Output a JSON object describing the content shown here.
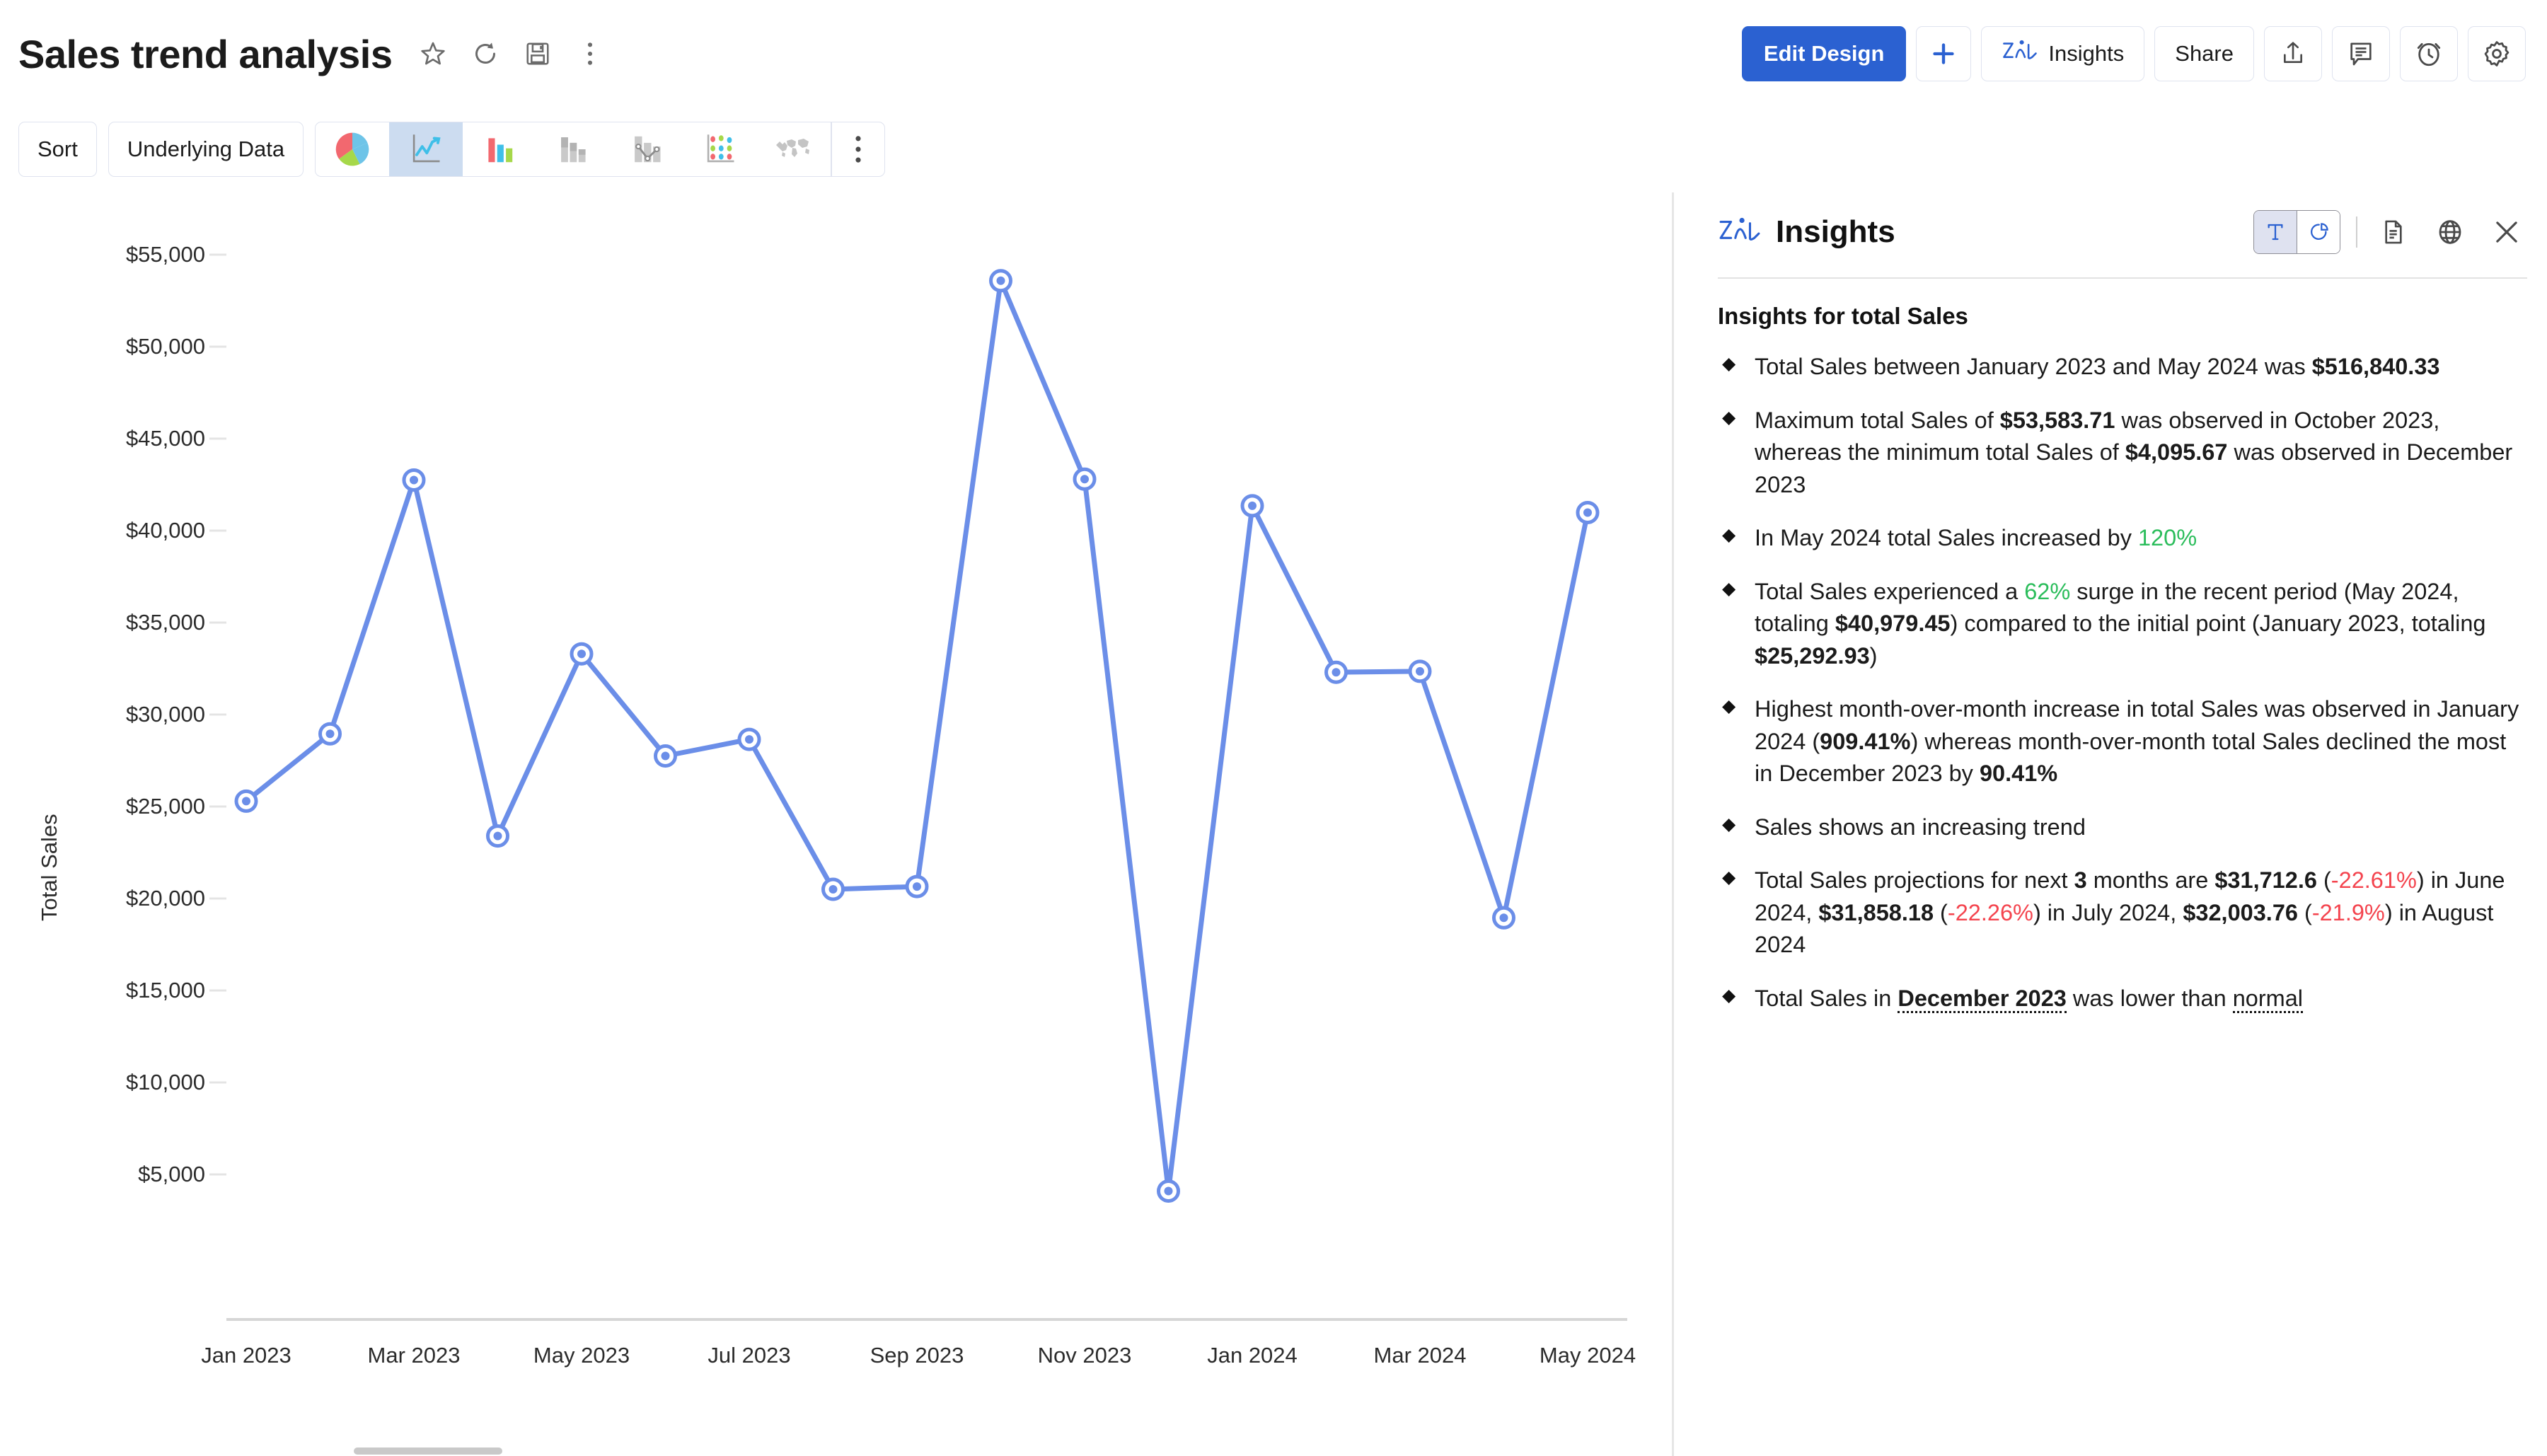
{
  "header": {
    "title": "Sales trend analysis",
    "icons": [
      {
        "name": "favorite-star-icon",
        "glyph": "star"
      },
      {
        "name": "refresh-icon",
        "glyph": "refresh"
      },
      {
        "name": "save-icon",
        "glyph": "save"
      },
      {
        "name": "more-options-icon",
        "glyph": "kebab"
      }
    ],
    "edit_design_label": "Edit Design",
    "add_label": "+",
    "insights_label": "Insights",
    "share_label": "Share",
    "right_icons": [
      {
        "name": "export-icon",
        "glyph": "export"
      },
      {
        "name": "comment-icon",
        "glyph": "comment"
      },
      {
        "name": "alert-clock-icon",
        "glyph": "alarm"
      },
      {
        "name": "settings-gear-icon",
        "glyph": "gear"
      }
    ]
  },
  "toolbar": {
    "sort_label": "Sort",
    "underlying_data_label": "Underlying Data",
    "chart_types": [
      {
        "name": "chart-type-pie",
        "active": false
      },
      {
        "name": "chart-type-line",
        "active": true
      },
      {
        "name": "chart-type-bar",
        "active": false
      },
      {
        "name": "chart-type-stacked-bar",
        "active": false
      },
      {
        "name": "chart-type-combo",
        "active": false
      },
      {
        "name": "chart-type-bubble",
        "active": false
      },
      {
        "name": "chart-type-map",
        "active": false
      }
    ],
    "more_label": "⋮"
  },
  "chart_data": {
    "type": "line",
    "title": "",
    "xlabel": "",
    "ylabel": "Total Sales",
    "ylim": [
      2500,
      55900
    ],
    "grid": true,
    "legend_position": "none",
    "accent_color": "#6b8ee8",
    "ytick_labels": [
      "$55,000",
      "$50,000",
      "$45,000",
      "$40,000",
      "$35,000",
      "$30,000",
      "$25,000",
      "$20,000",
      "$15,000",
      "$10,000",
      "$5,000"
    ],
    "ytick_values": [
      55000,
      50000,
      45000,
      40000,
      35000,
      30000,
      25000,
      20000,
      15000,
      10000,
      5000
    ],
    "xtick_labels": [
      "Jan 2023",
      "Mar 2023",
      "May 2023",
      "Jul 2023",
      "Sep 2023",
      "Nov 2023",
      "Jan 2024",
      "Mar 2024",
      "May 2024"
    ],
    "categories": [
      "Jan 2023",
      "Feb 2023",
      "Mar 2023",
      "Apr 2023",
      "May 2023",
      "Jun 2023",
      "Jul 2023",
      "Aug 2023",
      "Sep 2023",
      "Oct 2023",
      "Nov 2023",
      "Dec 2023",
      "Jan 2024",
      "Feb 2024",
      "Mar 2024",
      "Apr 2024",
      "May 2024"
    ],
    "values": [
      25292.93,
      28950,
      42750,
      23400,
      33300,
      27750,
      28650,
      20500,
      20650,
      53583.71,
      42800,
      4095.67,
      41350,
      32300,
      32350,
      18950,
      40979.45
    ],
    "series": [
      {
        "name": "Total Sales",
        "values": [
          25292.93,
          28950,
          42750,
          23400,
          33300,
          27750,
          28650,
          20500,
          20650,
          53583.71,
          42800,
          4095.67,
          41350,
          32300,
          32350,
          18950,
          40979.45
        ]
      }
    ]
  },
  "insights": {
    "panel_title": "Insights",
    "subtitle": "Insights for total Sales",
    "toggle": [
      {
        "name": "insights-text-view-toggle",
        "label": "T",
        "active": true
      },
      {
        "name": "insights-chart-view-toggle",
        "label": "pie",
        "active": false
      }
    ],
    "header_icons": [
      {
        "name": "document-export-icon"
      },
      {
        "name": "globe-icon"
      },
      {
        "name": "close-icon"
      }
    ],
    "bullets": [
      {
        "id": "total-sales-range",
        "parts": [
          {
            "t": "Total Sales between January 2023 and May 2024 was ",
            "s": "n"
          },
          {
            "t": "$516,840.33",
            "s": "b"
          }
        ]
      },
      {
        "id": "max-min-sales",
        "parts": [
          {
            "t": "Maximum total Sales of ",
            "s": "n"
          },
          {
            "t": "$53,583.71",
            "s": "b"
          },
          {
            "t": " was observed in October 2023, whereas the minimum total Sales of ",
            "s": "n"
          },
          {
            "t": "$4,095.67",
            "s": "b"
          },
          {
            "t": " was observed in December 2023",
            "s": "n"
          }
        ]
      },
      {
        "id": "may-2024-increase",
        "parts": [
          {
            "t": "In May 2024 total Sales increased by ",
            "s": "n"
          },
          {
            "t": "120%",
            "s": "g"
          }
        ]
      },
      {
        "id": "recent-surge",
        "parts": [
          {
            "t": "Total Sales experienced a ",
            "s": "n"
          },
          {
            "t": "62%",
            "s": "g"
          },
          {
            "t": " surge in the recent period (May 2024, totaling ",
            "s": "n"
          },
          {
            "t": "$40,979.45",
            "s": "b"
          },
          {
            "t": ") compared to the initial point (January 2023, totaling ",
            "s": "n"
          },
          {
            "t": "$25,292.93",
            "s": "b"
          },
          {
            "t": ")",
            "s": "n"
          }
        ]
      },
      {
        "id": "mom-change",
        "parts": [
          {
            "t": "Highest month-over-month increase in total Sales was observed in January 2024 (",
            "s": "n"
          },
          {
            "t": "909.41%",
            "s": "b"
          },
          {
            "t": ") whereas month-over-month total Sales declined the most in December 2023 by ",
            "s": "n"
          },
          {
            "t": "90.41%",
            "s": "b"
          }
        ]
      },
      {
        "id": "trend",
        "parts": [
          {
            "t": "Sales shows an increasing trend",
            "s": "n"
          }
        ]
      },
      {
        "id": "projections",
        "parts": [
          {
            "t": "Total Sales projections for next ",
            "s": "n"
          },
          {
            "t": "3",
            "s": "b"
          },
          {
            "t": " months are ",
            "s": "n"
          },
          {
            "t": "$31,712.6",
            "s": "b"
          },
          {
            "t": " (",
            "s": "n"
          },
          {
            "t": "-22.61%",
            "s": "r"
          },
          {
            "t": ") in June 2024, ",
            "s": "n"
          },
          {
            "t": "$31,858.18",
            "s": "b"
          },
          {
            "t": " (",
            "s": "n"
          },
          {
            "t": "-22.26%",
            "s": "r"
          },
          {
            "t": ") in July 2024, ",
            "s": "n"
          },
          {
            "t": "$32,003.76",
            "s": "b"
          },
          {
            "t": " (",
            "s": "n"
          },
          {
            "t": "-21.9%",
            "s": "r"
          },
          {
            "t": ") in August 2024",
            "s": "n"
          }
        ]
      },
      {
        "id": "december-anomaly",
        "parts": [
          {
            "t": "Total Sales in ",
            "s": "n"
          },
          {
            "t": "December 2023",
            "s": "d"
          },
          {
            "t": " was lower than ",
            "s": "n"
          },
          {
            "t": "normal",
            "s": "dn"
          }
        ]
      }
    ]
  }
}
